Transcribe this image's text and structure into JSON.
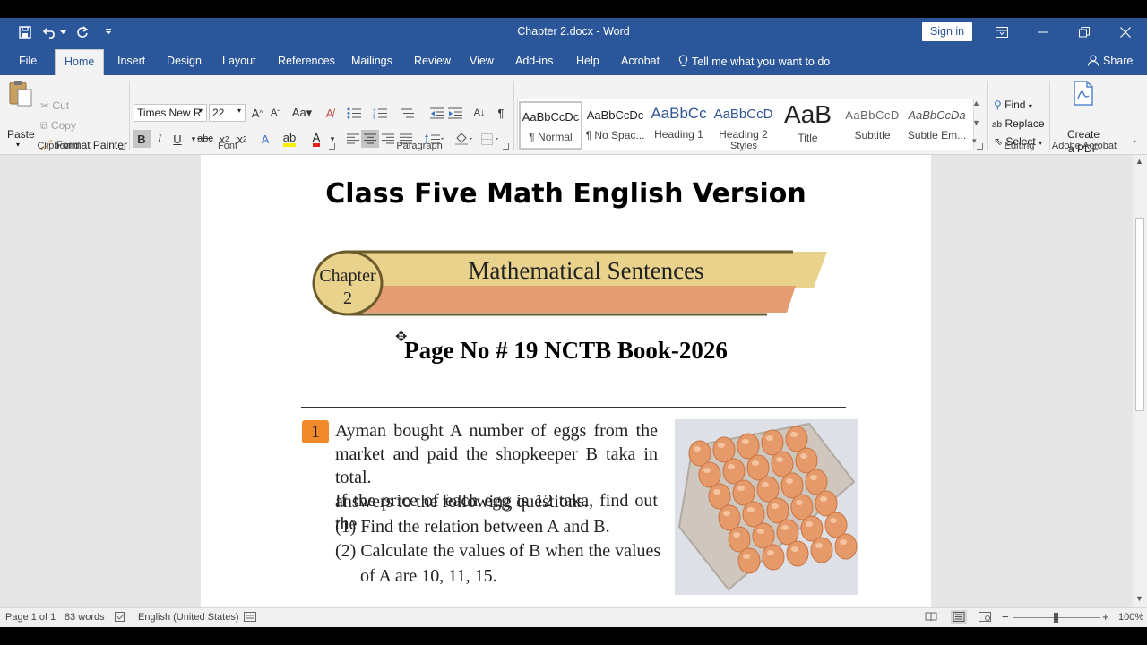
{
  "window": {
    "doc_title": "Chapter 2.docx  -  Word",
    "sign_in": "Sign in"
  },
  "tabs": [
    "File",
    "Home",
    "Insert",
    "Design",
    "Layout",
    "References",
    "Mailings",
    "Review",
    "View",
    "Add-ins",
    "Help",
    "Acrobat"
  ],
  "tell_me": "Tell me what you want to do",
  "share": "Share",
  "clipboard": {
    "paste": "Paste",
    "cut": "Cut",
    "copy": "Copy",
    "format_painter": "Format Painter",
    "label": "Clipboard"
  },
  "font": {
    "name": "Times New R",
    "size": "22",
    "label": "Font"
  },
  "paragraph": {
    "label": "Paragraph"
  },
  "styles": {
    "label": "Styles",
    "items": [
      {
        "preview": "AaBbCcDc",
        "name": "¶ Normal"
      },
      {
        "preview": "AaBbCcDc",
        "name": "¶ No Spac..."
      },
      {
        "preview": "AaBbCc",
        "name": "Heading 1"
      },
      {
        "preview": "AaBbCcD",
        "name": "Heading 2"
      },
      {
        "preview": "AaB",
        "name": "Title"
      },
      {
        "preview": "AaBbCcD",
        "name": "Subtitle"
      },
      {
        "preview": "AaBbCcDa",
        "name": "Subtle Em..."
      }
    ]
  },
  "editing": {
    "find": "Find",
    "replace": "Replace",
    "select": "Select",
    "label": "Editing"
  },
  "acrobat": {
    "create_line1": "Create",
    "create_line2": "a PDF",
    "label": "Adobe Acrobat"
  },
  "document": {
    "heading": "Class Five Math English Version",
    "banner_chapter": "Chapter",
    "banner_num": "2",
    "banner_title": "Mathematical Sentences",
    "page_no": "Page No # 19 NCTB Book-2026",
    "question_number": "1",
    "question_lines": [
      "Ayman bought A number of eggs from the",
      "market and paid the shopkeeper B taka in total.",
      "If the price of each egg is 12 taka, find out the"
    ],
    "question_last": "answers to the following questions.",
    "sub1": "(1) Find the relation between A and B.",
    "sub2": "(2) Calculate the values of B when the values",
    "sub2b": "of A are 10, 11, 15."
  },
  "status": {
    "page": "Page 1 of 1",
    "words": "83 words",
    "language": "English (United States)",
    "zoom": "100%"
  },
  "colors": {
    "word_blue": "#2b579a",
    "banner_gold": "#e9d28c",
    "banner_salmon": "#e59c72",
    "badge_orange": "#f08a2a"
  }
}
